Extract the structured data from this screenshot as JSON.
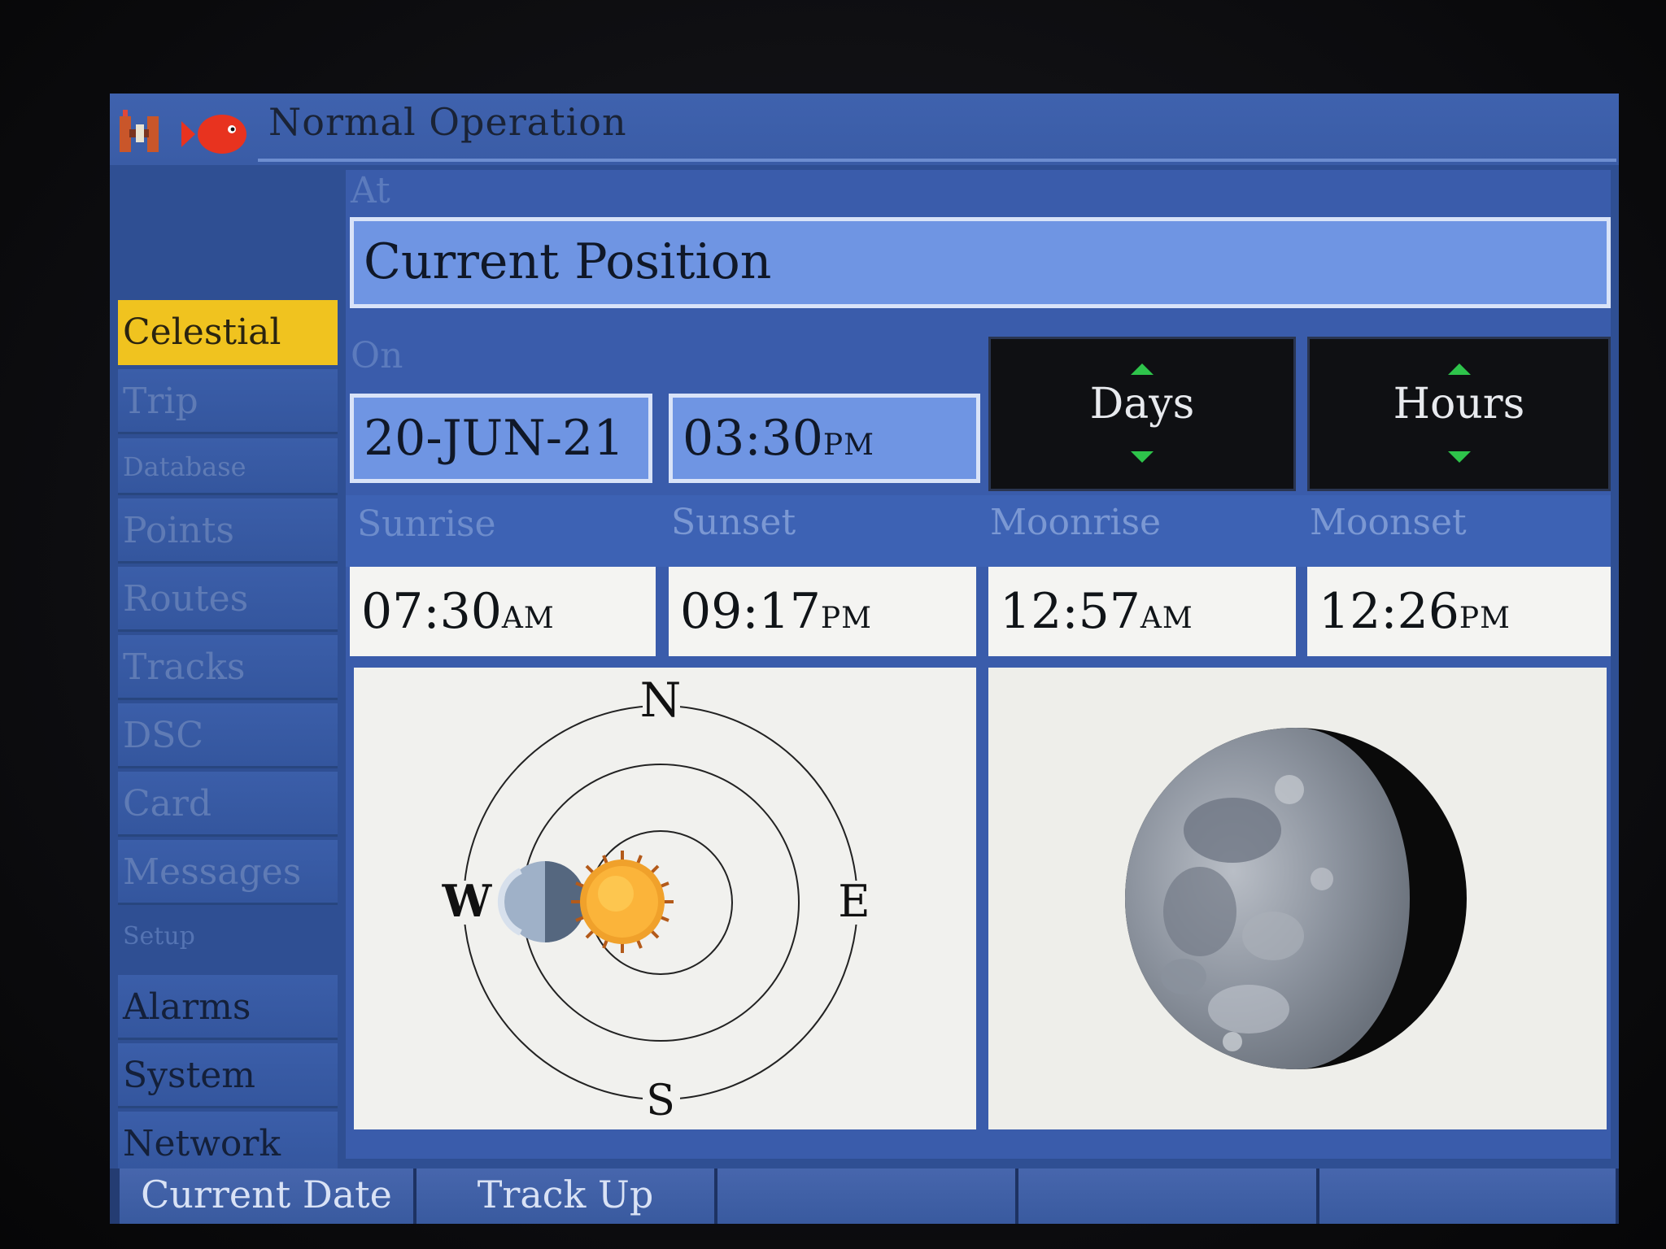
{
  "status_bar": {
    "title": "Normal Operation",
    "logo_icon": "satellite-fish-logo"
  },
  "sidebar": {
    "items": [
      {
        "label": "Celestial",
        "state": "selected"
      },
      {
        "label": "Trip",
        "state": "dim"
      },
      {
        "label": "Database",
        "state": "dim"
      },
      {
        "label": "Points",
        "state": "dim"
      },
      {
        "label": "Routes",
        "state": "dim"
      },
      {
        "label": "Tracks",
        "state": "dim"
      },
      {
        "label": "DSC",
        "state": "dim"
      },
      {
        "label": "Card",
        "state": "dim"
      },
      {
        "label": "Messages",
        "state": "dim"
      },
      {
        "label": "Setup",
        "state": "header"
      },
      {
        "label": "Alarms",
        "state": "active"
      },
      {
        "label": "System",
        "state": "active"
      },
      {
        "label": "Network",
        "state": "active"
      }
    ]
  },
  "celestial": {
    "at_label": "At",
    "position_value": "Current Position",
    "on_label": "On",
    "date_value": "20-JUN-21",
    "time_value": "03:30",
    "time_suffix": "PM",
    "days_label": "Days",
    "hours_label": "Hours",
    "sunrise_label": "Sunrise",
    "sunrise_time": "07:30",
    "sunrise_suffix": "AM",
    "sunset_label": "Sunset",
    "sunset_time": "09:17",
    "sunset_suffix": "PM",
    "moonrise_label": "Moonrise",
    "moonrise_time": "12:57",
    "moonrise_suffix": "AM",
    "moonset_label": "Moonset",
    "moonset_time": "12:26",
    "moonset_suffix": "PM",
    "compass": {
      "north": "N",
      "south": "S",
      "east": "E",
      "west": "W"
    },
    "moon_phase_icon": "waxing-crescent-moon-icon"
  },
  "softkeys": {
    "items": [
      "Current Date",
      "Track Up",
      "",
      "",
      ""
    ]
  },
  "colors": {
    "selected": "#f0c31f",
    "screen_blue": "#3a5cab",
    "field_blue": "#6f95e3",
    "arrow_green": "#2ec44b"
  }
}
